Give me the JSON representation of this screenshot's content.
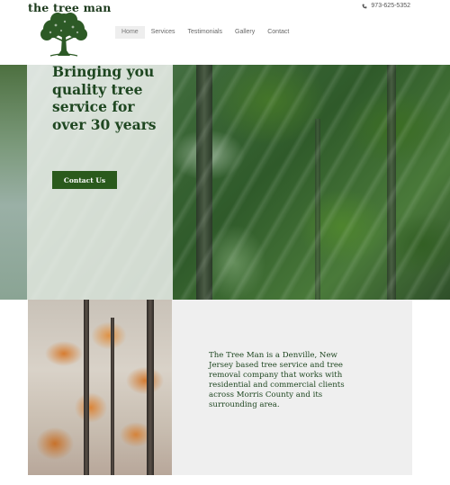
{
  "brand": {
    "name": "the tree man"
  },
  "header": {
    "phone": "973-625-5352"
  },
  "nav": {
    "items": [
      {
        "label": "Home",
        "active": true
      },
      {
        "label": "Services",
        "active": false
      },
      {
        "label": "Testimonials",
        "active": false
      },
      {
        "label": "Gallery",
        "active": false
      },
      {
        "label": "Contact",
        "active": false
      }
    ]
  },
  "hero": {
    "heading": "Bringing you quality tree service for over 30 years",
    "cta_label": "Contact Us"
  },
  "about": {
    "text": "The Tree Man is a Denville, New Jersey based tree service and tree removal company that works with residential and commercial clients across Morris County and its surrounding area."
  },
  "colors": {
    "accent": "#2a5a1c",
    "heading": "#1e4620",
    "panel": "#efefef"
  },
  "icons": {
    "phone": "phone-icon",
    "logo": "tree-logo-icon"
  }
}
